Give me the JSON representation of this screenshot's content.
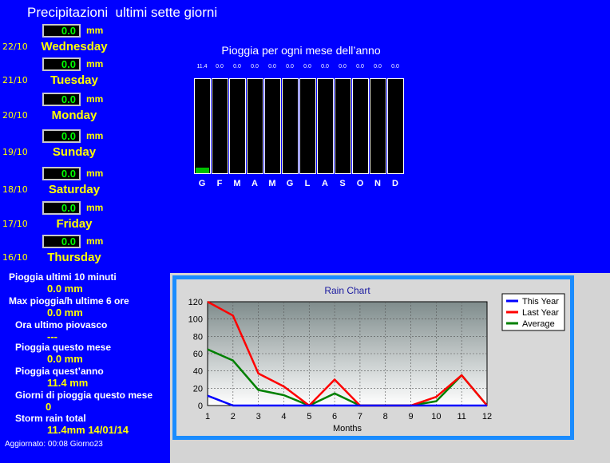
{
  "title": "Precipitazioni  ultimi sette giorni",
  "days": [
    {
      "date": "22/10",
      "value": "0.0",
      "unit": "mm",
      "name": "Wednesday"
    },
    {
      "date": "21/10",
      "value": "0.0",
      "unit": "mm",
      "name": "Tuesday"
    },
    {
      "date": "20/10",
      "value": "0.0",
      "unit": "mm",
      "name": "Monday"
    },
    {
      "date": "19/10",
      "value": "0.0",
      "unit": "mm",
      "name": "Sunday"
    },
    {
      "date": "18/10",
      "value": "0.0",
      "unit": "mm",
      "name": "Saturday"
    },
    {
      "date": "17/10",
      "value": "0.0",
      "unit": "mm",
      "name": "Friday"
    },
    {
      "date": "16/10",
      "value": "0.0",
      "unit": "mm",
      "name": "Thursday"
    }
  ],
  "monthly": {
    "title": "Pioggia per ogni mese dell’anno",
    "values": [
      "11.4",
      "0.0",
      "0.0",
      "0.0",
      "0.0",
      "0.0",
      "0.0",
      "0.0",
      "0.0",
      "0.0",
      "0.0",
      "0.0"
    ],
    "labels": [
      "G",
      "F",
      "M",
      "A",
      "M",
      "G",
      "L",
      "A",
      "S",
      "O",
      "N",
      "D"
    ],
    "fill_fraction": [
      0.06,
      0,
      0,
      0,
      0,
      0,
      0,
      0,
      0,
      0,
      0,
      0
    ],
    "bar_color": "#00c000"
  },
  "stats": {
    "rain_10min_label": "Pioggia ultimi 10 minuti",
    "rain_10min_value": "0.0 mm",
    "max_rate_label": "Max pioggia/h ultime 6 ore",
    "max_rate_value": "0.0 mm",
    "last_shower_label": "Ora ultimo piovasco",
    "last_shower_value": "---",
    "month_label": "Pioggia questo mese",
    "month_value": "0.0 mm",
    "year_label": "Pioggia quest’anno",
    "year_value": "11.4 mm",
    "rain_days_label": "Giorni di pioggia questo mese",
    "rain_days_value": "0",
    "storm_label": "Storm rain total",
    "storm_value": "11.4mm 14/01/14"
  },
  "updated": "Aggiornato: 00:08 Giorno23",
  "chart_data": {
    "type": "line",
    "title": "Rain Chart",
    "xlabel": "Months",
    "ylabel": "",
    "x": [
      1,
      2,
      3,
      4,
      5,
      6,
      7,
      8,
      9,
      10,
      11,
      12
    ],
    "xlim": [
      1,
      12
    ],
    "ylim": [
      0,
      120
    ],
    "yticks": [
      0,
      20,
      40,
      60,
      80,
      100,
      120
    ],
    "grid": true,
    "legend": "top-right",
    "series": [
      {
        "name": "This Year",
        "color": "#0000ff",
        "values": [
          11.4,
          0,
          0,
          0,
          0,
          0,
          0,
          0,
          0,
          0,
          0,
          0
        ]
      },
      {
        "name": "Last Year",
        "color": "#ff0000",
        "values": [
          120,
          104,
          37,
          22,
          0,
          30,
          0,
          0,
          0,
          10,
          35,
          0
        ]
      },
      {
        "name": "Average",
        "color": "#008000",
        "values": [
          65,
          52,
          18,
          12,
          0,
          14,
          0,
          0,
          0,
          5,
          35,
          0
        ]
      }
    ]
  }
}
